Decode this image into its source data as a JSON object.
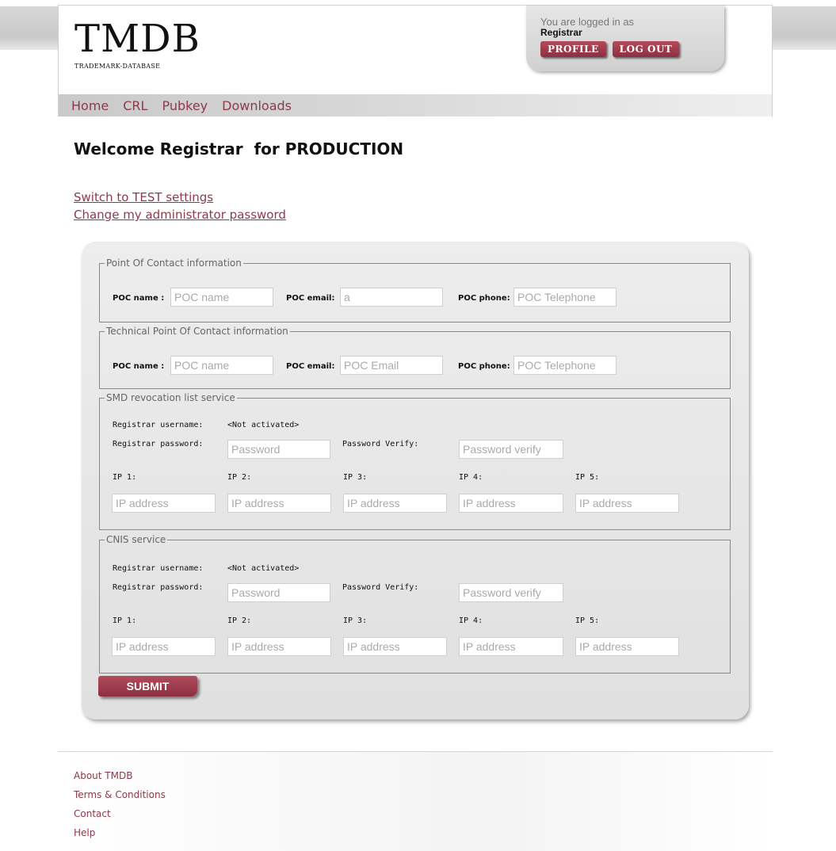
{
  "header": {
    "logo_main": "TMDB",
    "logo_sub": "TRADEMARK-DATABASE",
    "login_label": "You are logged in as",
    "login_user": "Registrar",
    "profile_label": "PROFILE",
    "logout_label": "LOG OUT"
  },
  "nav": [
    "Home",
    "CRL",
    "Pubkey",
    "Downloads"
  ],
  "page": {
    "title": "Welcome Registrar  for PRODUCTION",
    "links": [
      "Switch to TEST settings",
      "Change my administrator password"
    ]
  },
  "form": {
    "poc": {
      "legend": "Point Of Contact information",
      "name_label": "POC name :",
      "name_placeholder": "POC name",
      "email_label": "POC email:",
      "email_value": "a",
      "phone_label": "POC phone:",
      "phone_placeholder": "POC Telephone"
    },
    "tech_poc": {
      "legend": "Technical Point Of Contact information",
      "name_label": "POC name :",
      "name_placeholder": "POC name",
      "email_label": "POC email:",
      "email_placeholder": "POC Email",
      "phone_label": "POC phone:",
      "phone_placeholder": "POC Telephone"
    },
    "smd": {
      "legend": "SMD revocation list service",
      "username_label": "Registrar username:",
      "username_value": "<Not activated>",
      "password_label": "Registrar password:",
      "password_placeholder": "Password",
      "verify_label": "Password Verify:",
      "verify_placeholder": "Password verify",
      "ip_labels": [
        "IP 1:",
        "IP 2:",
        "IP 3:",
        "IP 4:",
        "IP 5:"
      ],
      "ip_placeholder": "IP address"
    },
    "cnis": {
      "legend": "CNIS service",
      "username_label": "Registrar username:",
      "username_value": "<Not activated>",
      "password_label": "Registrar password:",
      "password_placeholder": "Password",
      "verify_label": "Password Verify:",
      "verify_placeholder": "Password verify",
      "ip_labels": [
        "IP 1:",
        "IP 2:",
        "IP 3:",
        "IP 4:",
        "IP 5:"
      ],
      "ip_placeholder": "IP address"
    },
    "submit_label": "SUBMIT"
  },
  "footer": [
    "About TMDB",
    "Terms & Conditions",
    "Contact",
    "Help"
  ],
  "colors": {
    "accent": "#8d3a4a",
    "button": "#9c3a4b"
  }
}
